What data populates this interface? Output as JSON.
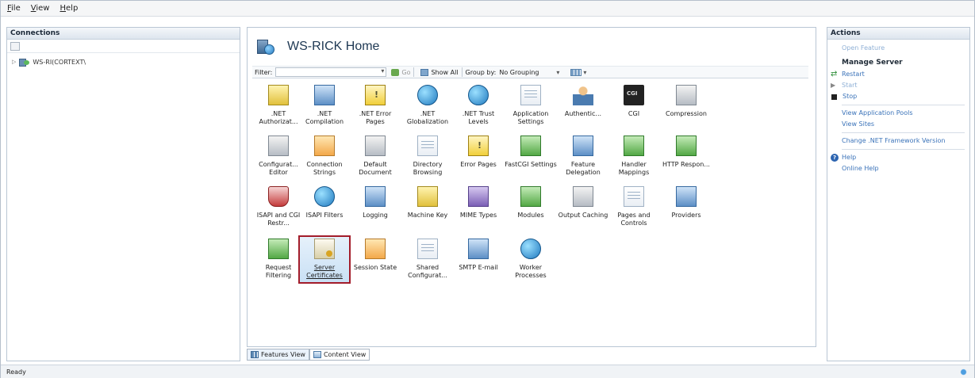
{
  "menu": [
    "File",
    "View",
    "Help"
  ],
  "connections": {
    "header": "Connections",
    "tree_node": "WS-RI(CORTEXT\\"
  },
  "home": {
    "title": "WS-RICK Home"
  },
  "filterbar": {
    "filter_label": "Filter:",
    "go_label": "Go",
    "show_all_label": "Show All",
    "group_by_label": "Group by:",
    "group_by_value": "No Grouping"
  },
  "features": [
    [
      {
        "label": ".NET Authorizat...",
        "icon": "dotnet-authorization-icon"
      },
      {
        "label": ".NET Compilation",
        "icon": "dotnet-compilation-icon"
      },
      {
        "label": ".NET Error Pages",
        "icon": "dotnet-error-pages-icon"
      },
      {
        "label": ".NET Globalization",
        "icon": "dotnet-globalization-icon"
      },
      {
        "label": ".NET Trust Levels",
        "icon": "dotnet-trust-levels-icon"
      },
      {
        "label": "Application Settings",
        "icon": "application-settings-icon"
      },
      {
        "label": "Authentic...",
        "icon": "authentication-icon"
      },
      {
        "label": "CGI",
        "icon": "cgi-icon"
      },
      {
        "label": "Compression",
        "icon": "compression-icon"
      }
    ],
    [
      {
        "label": "Configurat... Editor",
        "icon": "configuration-editor-icon"
      },
      {
        "label": "Connection Strings",
        "icon": "connection-strings-icon"
      },
      {
        "label": "Default Document",
        "icon": "default-document-icon"
      },
      {
        "label": "Directory Browsing",
        "icon": "directory-browsing-icon"
      },
      {
        "label": "Error Pages",
        "icon": "error-pages-icon"
      },
      {
        "label": "FastCGI Settings",
        "icon": "fastcgi-settings-icon"
      },
      {
        "label": "Feature Delegation",
        "icon": "feature-delegation-icon"
      },
      {
        "label": "Handler Mappings",
        "icon": "handler-mappings-icon"
      },
      {
        "label": "HTTP Respon...",
        "icon": "http-response-icon"
      }
    ],
    [
      {
        "label": "ISAPI and CGI Restr...",
        "icon": "isapi-cgi-restrictions-icon"
      },
      {
        "label": "ISAPI Filters",
        "icon": "isapi-filters-icon"
      },
      {
        "label": "Logging",
        "icon": "logging-icon"
      },
      {
        "label": "Machine Key",
        "icon": "machine-key-icon"
      },
      {
        "label": "MIME Types",
        "icon": "mime-types-icon"
      },
      {
        "label": "Modules",
        "icon": "modules-icon"
      },
      {
        "label": "Output Caching",
        "icon": "output-caching-icon"
      },
      {
        "label": "Pages and Controls",
        "icon": "pages-and-controls-icon"
      },
      {
        "label": "Providers",
        "icon": "providers-icon"
      }
    ],
    [
      {
        "label": "Request Filtering",
        "icon": "request-filtering-icon"
      },
      {
        "label": "Server Certificates",
        "icon": "server-certificates-icon",
        "selected": true
      },
      {
        "label": "Session State",
        "icon": "session-state-icon"
      },
      {
        "label": "Shared Configurat...",
        "icon": "shared-configuration-icon"
      },
      {
        "label": "SMTP E-mail",
        "icon": "smtp-email-icon"
      },
      {
        "label": "Worker Processes",
        "icon": "worker-processes-icon"
      }
    ]
  ],
  "bottom_tabs": {
    "features_view": "Features View",
    "content_view": "Content View"
  },
  "actions": {
    "header": "Actions",
    "open_feature": "Open Feature",
    "manage_server_heading": "Manage Server",
    "restart": "Restart",
    "start": "Start",
    "stop": "Stop",
    "view_app_pools": "View Application Pools",
    "view_sites": "View Sites",
    "change_framework": "Change .NET Framework Version",
    "help": "Help",
    "online_help": "Online Help"
  },
  "status": {
    "text": "Ready"
  }
}
